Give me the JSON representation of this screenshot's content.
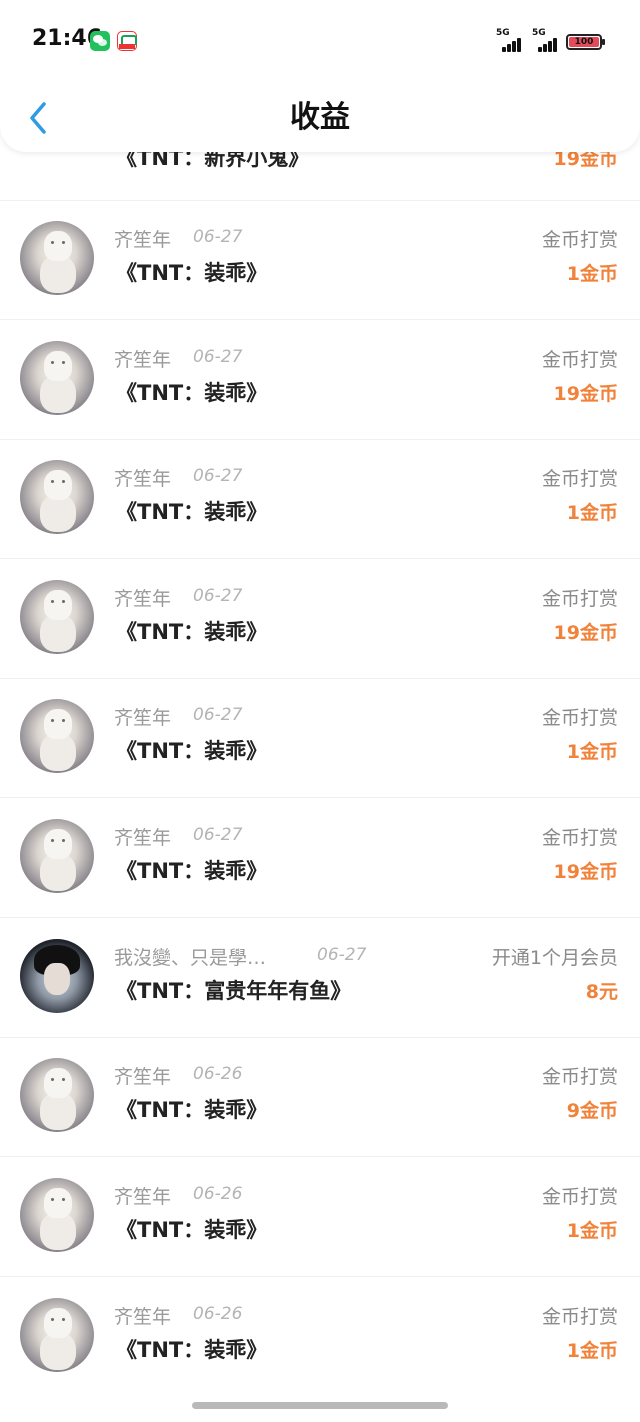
{
  "status_bar": {
    "time": "21:46",
    "network_1": "5G",
    "network_2": "5G",
    "battery": "100"
  },
  "header": {
    "title": "收益"
  },
  "rows": [
    {
      "name": "",
      "date": "",
      "title": "《TNT：新界小鬼》",
      "type": "",
      "amount": "19金币",
      "avatar": "gift"
    },
    {
      "name": "齐笙年",
      "date": "06-27",
      "title": "《TNT：装乖》",
      "type": "金币打赏",
      "amount": "1金币",
      "avatar": "cat"
    },
    {
      "name": "齐笙年",
      "date": "06-27",
      "title": "《TNT：装乖》",
      "type": "金币打赏",
      "amount": "19金币",
      "avatar": "cat"
    },
    {
      "name": "齐笙年",
      "date": "06-27",
      "title": "《TNT：装乖》",
      "type": "金币打赏",
      "amount": "1金币",
      "avatar": "cat"
    },
    {
      "name": "齐笙年",
      "date": "06-27",
      "title": "《TNT：装乖》",
      "type": "金币打赏",
      "amount": "19金币",
      "avatar": "cat"
    },
    {
      "name": "齐笙年",
      "date": "06-27",
      "title": "《TNT：装乖》",
      "type": "金币打赏",
      "amount": "1金币",
      "avatar": "cat"
    },
    {
      "name": "齐笙年",
      "date": "06-27",
      "title": "《TNT：装乖》",
      "type": "金币打赏",
      "amount": "19金币",
      "avatar": "cat"
    },
    {
      "name": "我沒變、只是學…",
      "date": "06-27",
      "title": "《TNT：富贵年年有鱼》",
      "type": "开通1个月会员",
      "amount": "8元",
      "avatar": "person"
    },
    {
      "name": "齐笙年",
      "date": "06-26",
      "title": "《TNT：装乖》",
      "type": "金币打赏",
      "amount": "9金币",
      "avatar": "cat"
    },
    {
      "name": "齐笙年",
      "date": "06-26",
      "title": "《TNT：装乖》",
      "type": "金币打赏",
      "amount": "1金币",
      "avatar": "cat"
    },
    {
      "name": "齐笙年",
      "date": "06-26",
      "title": "《TNT：装乖》",
      "type": "金币打赏",
      "amount": "1金币",
      "avatar": "cat"
    }
  ]
}
